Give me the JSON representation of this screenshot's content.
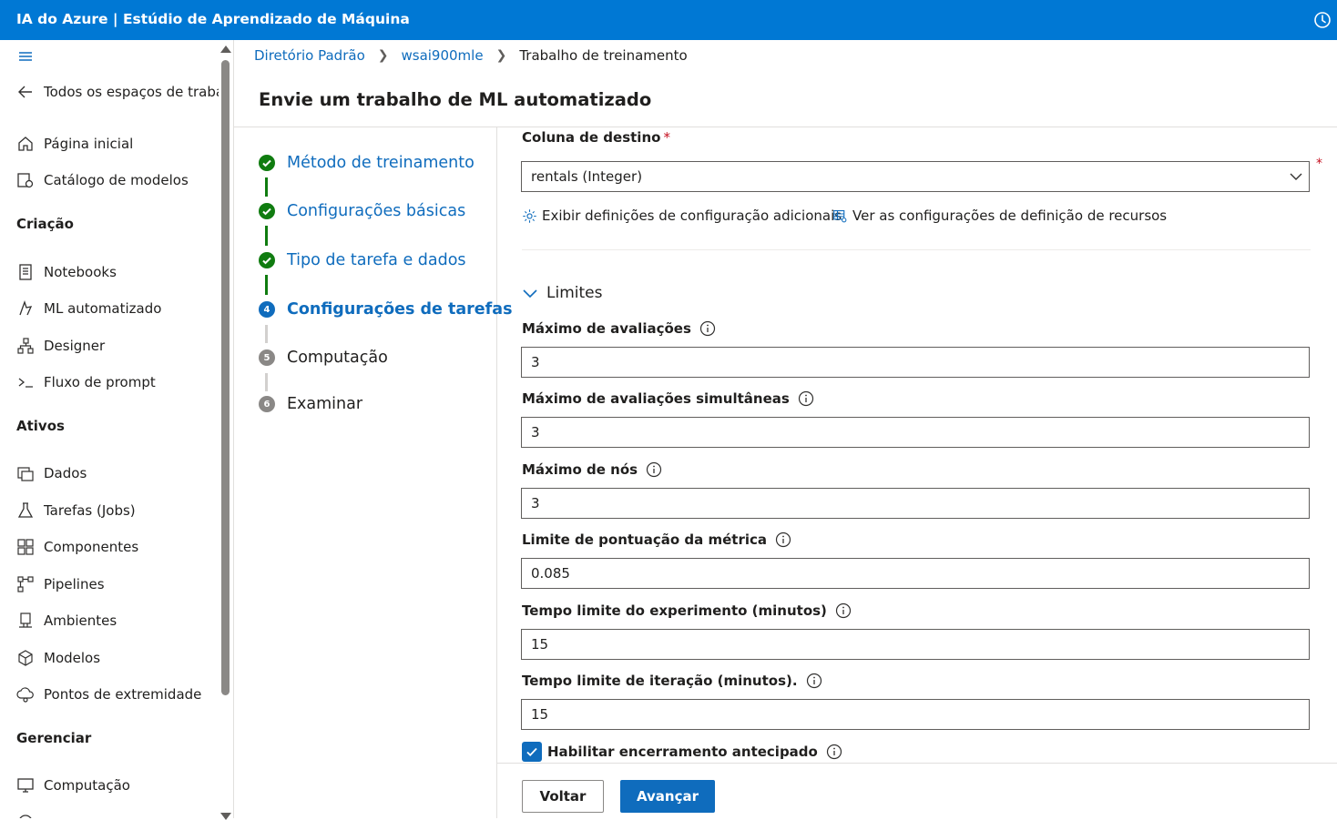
{
  "app": {
    "title": "IA do Azure | Estúdio de Aprendizado de Máquina"
  },
  "sidebar": {
    "back_label": "Todos os espaços de trabal",
    "home_label": "Página inicial",
    "catalog_label": "Catálogo de modelos",
    "sections": {
      "authoring": "Criação",
      "assets": "Ativos",
      "manage": "Gerenciar"
    },
    "authoring_items": [
      "Notebooks",
      "ML automatizado",
      "Designer",
      "Fluxo de prompt"
    ],
    "assets_items": [
      "Dados",
      "Tarefas (Jobs)",
      "Componentes",
      "Pipelines",
      "Ambientes",
      "Modelos",
      "Pontos de extremidade"
    ],
    "manage_items": [
      "Computação"
    ]
  },
  "breadcrumb": [
    "Diretório Padrão",
    "wsai900mle",
    "Trabalho de treinamento"
  ],
  "page_title": "Envie um trabalho de ML automatizado",
  "steps": [
    {
      "label": "Método de treinamento",
      "marker": ""
    },
    {
      "label": "Configurações básicas",
      "marker": ""
    },
    {
      "label": "Tipo de tarefa e dados",
      "marker": ""
    },
    {
      "label": "Configurações de tarefas",
      "marker": "4"
    },
    {
      "label": "Computação",
      "marker": "5"
    },
    {
      "label": "Examinar",
      "marker": "6"
    }
  ],
  "form": {
    "target_label": "Coluna de destino",
    "required_mark": "*",
    "target_value": "rentals (Integer)",
    "link_additional": "Exibir definições de configuração adicionais",
    "link_featurization": "Ver as configurações de definição de recursos",
    "limits_title": "Limites",
    "fields": [
      {
        "label": "Máximo de avaliações",
        "value": "3"
      },
      {
        "label": "Máximo de avaliações simultâneas",
        "value": "3"
      },
      {
        "label": "Máximo de nós",
        "value": "3"
      },
      {
        "label": "Limite de pontuação da métrica",
        "value": "0.085"
      },
      {
        "label": "Tempo limite do experimento (minutos)",
        "value": "15"
      },
      {
        "label": "Tempo limite de iteração (minutos).",
        "value": "15"
      }
    ],
    "early_termination_label": "Habilitar encerramento antecipado",
    "early_termination_checked": true
  },
  "buttons": {
    "back": "Voltar",
    "next": "Avançar"
  },
  "colors": {
    "brand": "#0078d4",
    "accent": "#0f6cbd",
    "success": "#107c10"
  }
}
